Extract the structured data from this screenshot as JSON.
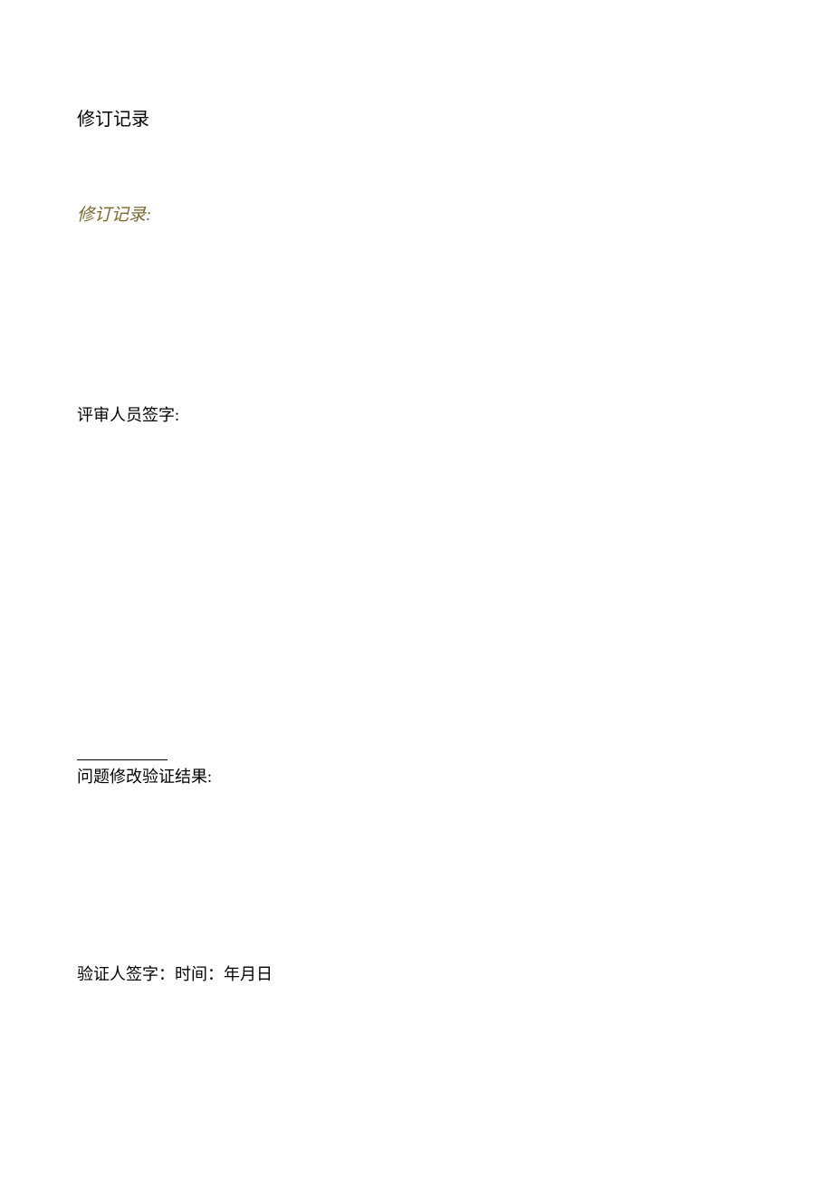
{
  "section_title": "修订记录",
  "revision_record_label": "修订记录:",
  "reviewer_signature_label": "评审人员签字:",
  "verification_result_label": "问题修改验证结果:",
  "verifier_signature_label": "验证人签字：时间：年月日"
}
